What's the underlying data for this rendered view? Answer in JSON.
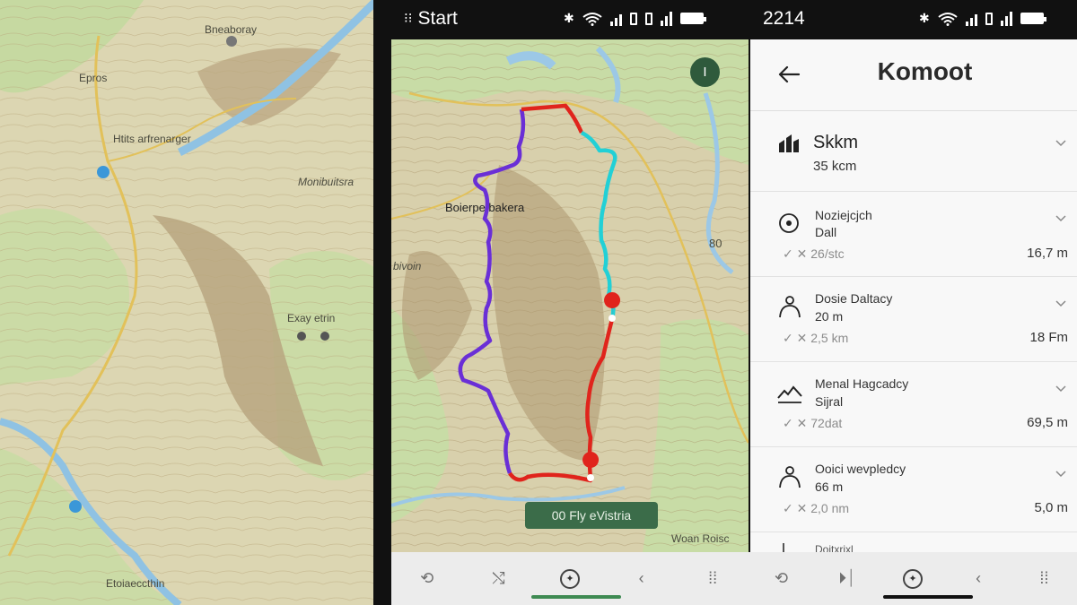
{
  "background_map": {
    "labels": [
      "Bneaboray",
      "Epros",
      "Htits arfrenarger",
      "Monibuitsra",
      "Exay etrin",
      "Etoiaeccthin"
    ]
  },
  "phone1": {
    "status": {
      "time": "Start",
      "grid_glyph": "⁝⁝"
    },
    "map": {
      "labels": [
        "Boierpe bakera",
        "bivoin",
        "80",
        "Woan Roisc"
      ],
      "route_colors": {
        "purple": "#6a2fd6",
        "cyan": "#22d0d6",
        "red": "#e0241c"
      },
      "fab_label": "I",
      "pill_label": "00 Fly eVistria"
    },
    "bottom_nav": [
      "back-square",
      "shuffle",
      "compass",
      "back-chevron",
      "grid"
    ]
  },
  "phone2": {
    "status": {
      "time": "2214"
    },
    "header": {
      "title": "Komoot",
      "back_label": "←"
    },
    "summary": {
      "title": "Skkm",
      "subtitle": "35 kcm"
    },
    "rows": [
      {
        "title": "Noziejcjch",
        "subtitle": "Dall",
        "meta": "✓ ✕ 26/stc",
        "value": "16,7 m",
        "icon": "steering-icon"
      },
      {
        "title": "Dosie Daltacy",
        "subtitle": "20 m",
        "meta": "✓ ✕ 2,5 km",
        "value": "18 Fm",
        "icon": "person-icon"
      },
      {
        "title": "Menal Hagcadcy",
        "subtitle": "Sijral",
        "meta": "✓ ✕ 72dat",
        "value": "69,5 m",
        "icon": "elevation-icon"
      },
      {
        "title": "Ooici wevpledcy",
        "subtitle": "66 m",
        "meta": "✓ ✕ 2,0 nm",
        "value": "5,0 m",
        "icon": "person-icon"
      },
      {
        "title": "Doitxrixl",
        "subtitle": "",
        "meta": "",
        "value": "",
        "icon": "pin-icon"
      }
    ],
    "bottom_nav": [
      "back-square",
      "skip",
      "compass",
      "back-chevron",
      "grid"
    ]
  },
  "colors": {
    "accent_green": "#3b6c49",
    "map_green": "#cfe0b0",
    "water": "#9cc8e6"
  }
}
